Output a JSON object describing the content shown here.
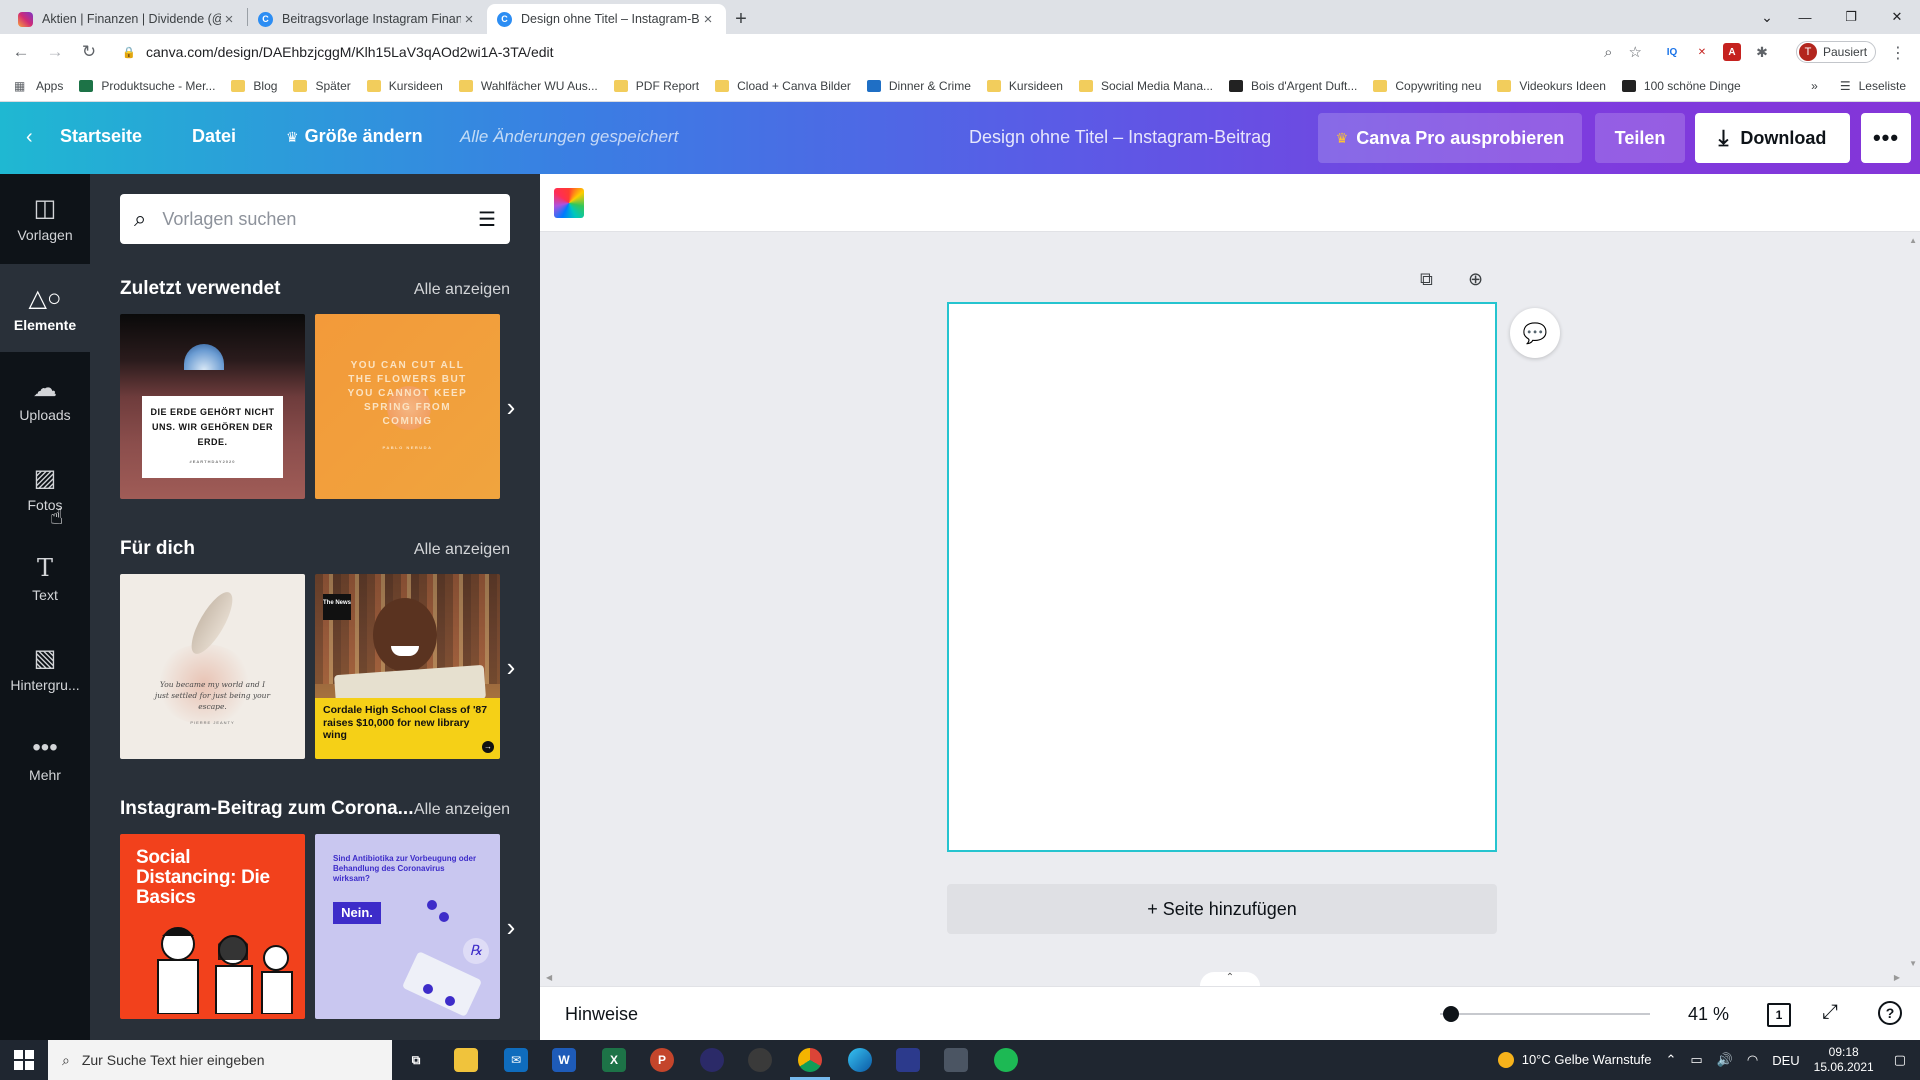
{
  "browser": {
    "tabs": [
      {
        "title": "Aktien | Finanzen | Dividende (@",
        "favicon": "instagram-icon",
        "active": false
      },
      {
        "title": "Beitragsvorlage Instagram Finanz",
        "favicon": "canva-icon",
        "active": false
      },
      {
        "title": "Design ohne Titel – Instagram-Be",
        "favicon": "canva-icon",
        "active": true
      }
    ],
    "url": "canva.com/design/DAEhbzjcggM/Klh15LaV3qAOd2wi1A-3TA/edit",
    "profile_status": "Pausiert",
    "profile_initial": "T",
    "bookmarks": [
      "Apps",
      "Produktsuche - Mer...",
      "Blog",
      "Später",
      "Kursideen",
      "Wahlfächer WU Aus...",
      "PDF Report",
      "Cload + Canva Bilder",
      "Dinner & Crime",
      "Kursideen",
      "Social Media Mana...",
      "Bois d'Argent Duft...",
      "Copywriting neu",
      "Videokurs Ideen",
      "100 schöne Dinge"
    ],
    "reading_list": "Leseliste",
    "more_bookmarks": "»"
  },
  "header": {
    "home": "Startseite",
    "file": "Datei",
    "resize": "Größe ändern",
    "saved_status": "Alle Änderungen gespeichert",
    "design_title": "Design ohne Titel – Instagram-Beitrag",
    "pro_button": "Canva Pro ausprobieren",
    "share_button": "Teilen",
    "download_button": "Download",
    "more_button": "•••"
  },
  "sidenav": [
    {
      "label": "Vorlagen",
      "icon": "templates-icon"
    },
    {
      "label": "Elemente",
      "icon": "elements-icon"
    },
    {
      "label": "Uploads",
      "icon": "upload-cloud-icon"
    },
    {
      "label": "Fotos",
      "icon": "photos-icon"
    },
    {
      "label": "Text",
      "icon": "text-icon"
    },
    {
      "label": "Hintergru...",
      "icon": "background-icon"
    },
    {
      "label": "Mehr",
      "icon": "more-icon"
    }
  ],
  "panel": {
    "search_placeholder": "Vorlagen suchen",
    "sections": [
      {
        "title": "Zuletzt verwendet",
        "see_all": "Alle anzeigen"
      },
      {
        "title": "Für dich",
        "see_all": "Alle anzeigen"
      },
      {
        "title": "Instagram-Beitrag zum Corona...",
        "see_all": "Alle anzeigen"
      }
    ],
    "thumbs": {
      "earth_quote": "DIE ERDE GEHÖRT NICHT UNS. WIR GEHÖREN DER ERDE.",
      "earth_tag": "#EARTHDAY2020",
      "flowers_quote": "YOU CAN CUT ALL THE FLOWERS BUT YOU CANNOT KEEP SPRING FROM COMING",
      "flowers_author": "PABLO NERUDA",
      "script_quote": "You became my world and I just settled for just being your escape.",
      "script_author": "PIERRE JEANTY",
      "news_badge": "The News",
      "news_caption": "Cordale High School Class of '87 raises $10,000 for new library wing",
      "social_title": "Social Distancing: Die Basics",
      "antibiotics_title": "Sind Antibiotika zur Vorbeugung oder Behandlung des Coronavirus wirksam?",
      "antibiotics_answer": "Nein."
    }
  },
  "editor": {
    "add_page": "+ Seite hinzufügen",
    "notes": "Hinweise",
    "zoom": "41 %",
    "zoom_fraction": 0.05,
    "page_count": "1",
    "help": "?"
  },
  "taskbar": {
    "search_placeholder": "Zur Suche Text hier eingeben",
    "weather": "10°C  Gelbe Warnstufe",
    "language": "DEU",
    "time": "09:18",
    "date": "15.06.2021"
  }
}
